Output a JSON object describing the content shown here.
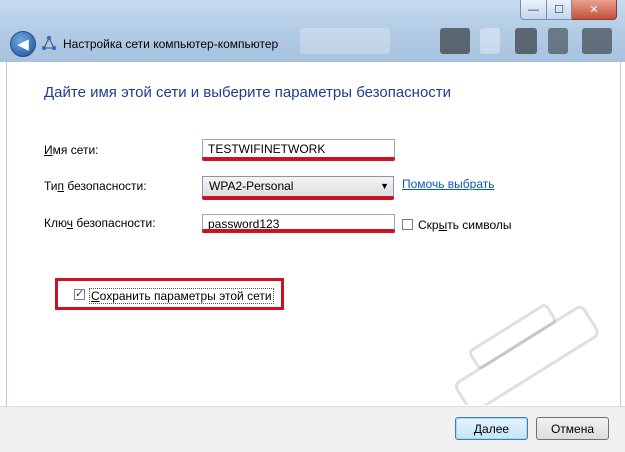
{
  "window": {
    "title": "Настройка сети компьютер-компьютер",
    "caption_min": "—",
    "caption_max": "☐",
    "caption_close": "✕",
    "back_glyph": "◀"
  },
  "heading": "Дайте имя этой сети и выберите параметры безопасности",
  "form": {
    "network_name": {
      "label_accel": "И",
      "label_rest": "мя сети:",
      "value": "TESTWIFINETWORK"
    },
    "security_type": {
      "label_pre": "Ти",
      "label_accel": "п",
      "label_rest": " безопасности:",
      "value": "WPA2-Personal",
      "help_link": "Помочь выбрать"
    },
    "security_key": {
      "label_pre": "Клю",
      "label_accel": "ч",
      "label_rest": " безопасности:",
      "value": "password123",
      "hide_chars_pre": "Скр",
      "hide_chars_accel": "ы",
      "hide_chars_rest": "ть символы",
      "hide_chars_checked": false
    },
    "save_settings": {
      "accel": "С",
      "rest": "охранить параметры этой сети",
      "checked": true
    }
  },
  "buttons": {
    "next_accel": "Д",
    "next_rest": "алее",
    "cancel": "Отмена"
  },
  "colors": {
    "heading": "#1e3f8c",
    "highlight_red": "#cc1122",
    "link": "#0a57b8"
  }
}
